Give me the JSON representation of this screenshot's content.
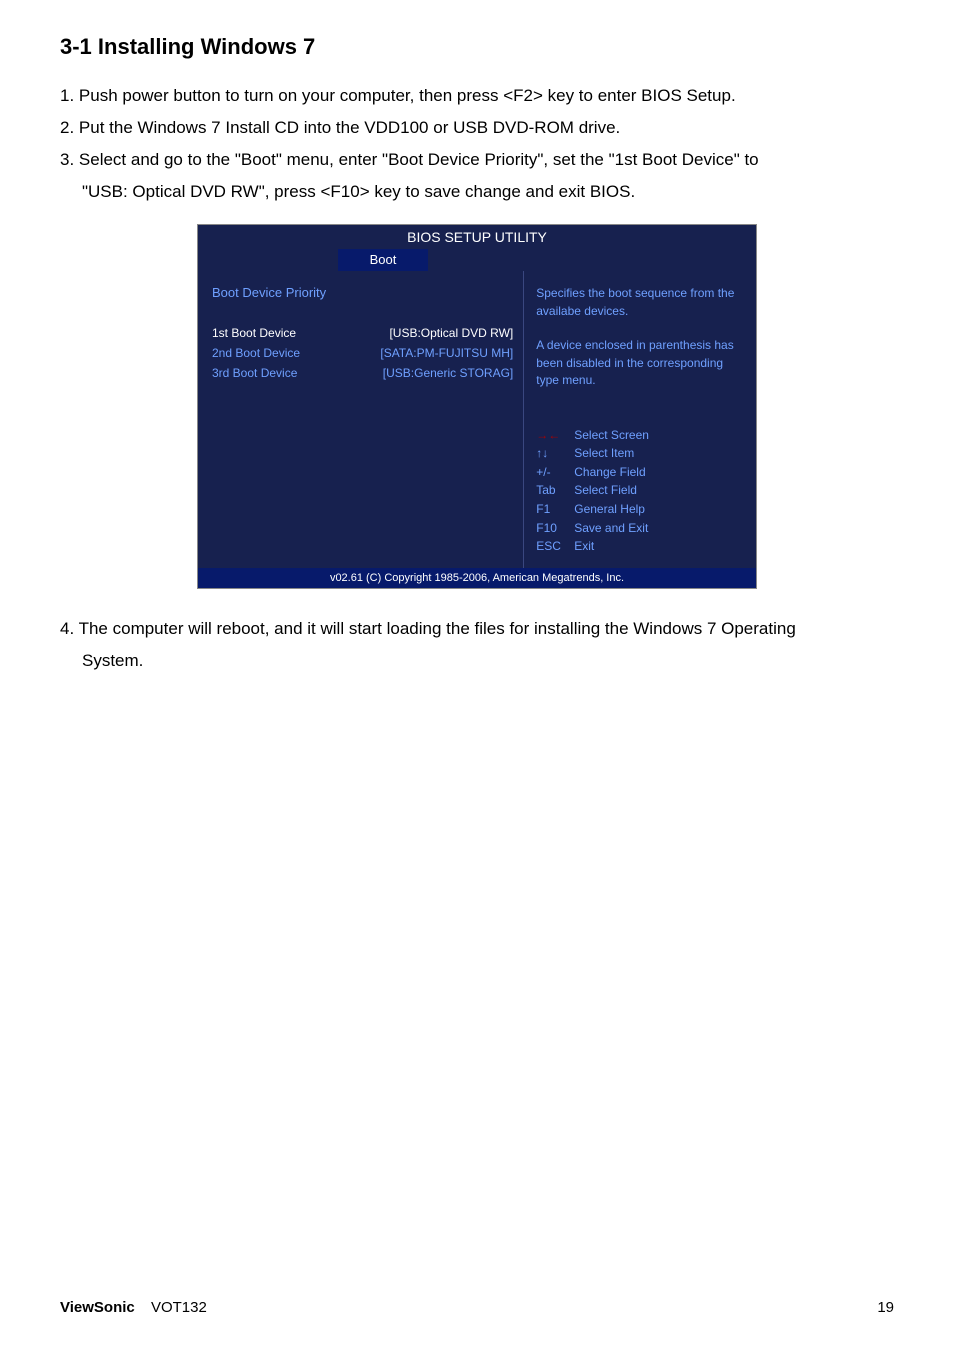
{
  "heading": "3-1 Installing Windows 7",
  "steps": {
    "s1": "1. Push power button to turn on your computer, then press <F2> key to enter BIOS Setup.",
    "s2": "2. Put the Windows 7 Install CD into the VDD100 or USB DVD-ROM drive.",
    "s3a": "3. Select and go to the \"Boot\" menu, enter \"Boot Device Priority\", set the \"1st Boot Device\" to",
    "s3b": "\"USB: Optical DVD RW\", press <F10> key to save change and exit BIOS.",
    "s4a": "4.  The computer will reboot, and it will start loading the files for installing the Windows 7 Operating",
    "s4b": "System."
  },
  "bios": {
    "title": "BIOS SETUP UTILITY",
    "tab": "Boot",
    "priority_label": "Boot Device Priority",
    "rows": [
      {
        "label": "1st Boot Device",
        "value": "[USB:Optical DVD RW]",
        "selected": true
      },
      {
        "label": "2nd Boot Device",
        "value": "[SATA:PM-FUJITSU MH]",
        "selected": false
      },
      {
        "label": "3rd Boot Device",
        "value": "[USB:Generic STORAG]",
        "selected": false
      }
    ],
    "help_top": "Specifies the boot sequence from the availabe devices.\n\nA device enclosed in parenthesis has been disabled in the corresponding type menu.",
    "help_keys": [
      {
        "key": "→←",
        "desc": "Select Screen",
        "red": true
      },
      {
        "key": "↑↓",
        "desc": "Select Item"
      },
      {
        "key": "+/-",
        "desc": "Change Field"
      },
      {
        "key": "Tab",
        "desc": "Select Field"
      },
      {
        "key": "F1",
        "desc": "General Help"
      },
      {
        "key": "F10",
        "desc": "Save and Exit"
      },
      {
        "key": "ESC",
        "desc": "Exit"
      }
    ],
    "footer": "v02.61 (C) Copyright 1985-2006, American Megatrends, Inc."
  },
  "footer": {
    "brand": "ViewSonic",
    "model": "VOT132",
    "page": "19"
  }
}
